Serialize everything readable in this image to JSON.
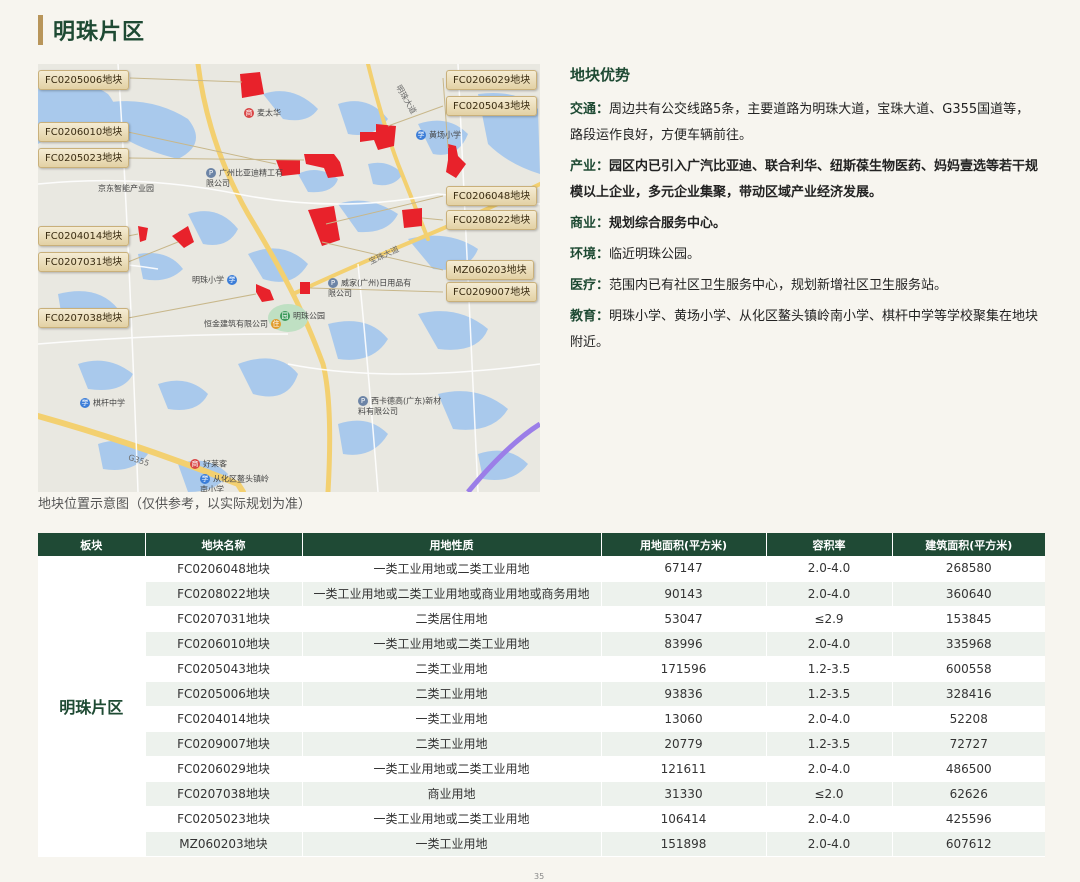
{
  "page": {
    "title": "明珠片区",
    "page_number": "35"
  },
  "map": {
    "caption": "地块位置示意图（仅供参考，以实际规划为准）",
    "parcel_tags": [
      "FC0205006地块",
      "FC0206010地块",
      "FC0205023地块",
      "FC0204014地块",
      "FC0207031地块",
      "FC0207038地块",
      "FC0206029地块",
      "FC0205043地块",
      "FC0206048地块",
      "FC0208022地块",
      "MZ060203地块",
      "FC0209007地块"
    ],
    "pois": {
      "p1": "麦太华",
      "p2": "黄场小学",
      "p3": "广州比亚迪精工有限公司",
      "p4": "京东智能产业园",
      "p5": "明珠小学",
      "p6": "恒金建筑有限公司",
      "p7": "明珠公园",
      "p8": "威家(广州)日用品有限公司",
      "p9": "棋杆中学",
      "p10": "西卡德高(广东)新材料有限公司",
      "p11": "好莱客",
      "p12": "从化区鳌头镇岭南小学"
    },
    "roads": {
      "r1": "明珠大道",
      "r2": "宝珠大道",
      "r3": "G355"
    }
  },
  "advantages": {
    "title": "地块优势",
    "items": [
      {
        "label": "交通：",
        "text": "周边共有公交线路5条，主要道路为明珠大道，宝珠大道、G355国道等，路段运作良好，方便车辆前往。",
        "bold": false
      },
      {
        "label": "产业：",
        "text": "园区内已引入广汽比亚迪、联合利华、纽斯葆生物医药、妈妈壹选等若干规模以上企业，多元企业集聚，带动区域产业经济发展。",
        "bold": true
      },
      {
        "label": "商业：",
        "text": "规划综合服务中心。",
        "bold": true
      },
      {
        "label": "环境：",
        "text": "临近明珠公园。",
        "bold": false
      },
      {
        "label": "医疗：",
        "text": "范围内已有社区卫生服务中心，规划新增社区卫生服务站。",
        "bold": false
      },
      {
        "label": "教育：",
        "text": "明珠小学、黄场小学、从化区鳌头镇岭南小学、棋杆中学等学校聚集在地块附近。",
        "bold": false
      }
    ]
  },
  "table": {
    "headers": [
      "板块",
      "地块名称",
      "用地性质",
      "用地面积(平方米)",
      "容积率",
      "建筑面积(平方米)"
    ],
    "region": "明珠片区",
    "rows": [
      [
        "FC0206048地块",
        "一类工业用地或二类工业用地",
        "67147",
        "2.0-4.0",
        "268580"
      ],
      [
        "FC0208022地块",
        "一类工业用地或二类工业用地或商业用地或商务用地",
        "90143",
        "2.0-4.0",
        "360640"
      ],
      [
        "FC0207031地块",
        "二类居住用地",
        "53047",
        "≤2.9",
        "153845"
      ],
      [
        "FC0206010地块",
        "一类工业用地或二类工业用地",
        "83996",
        "2.0-4.0",
        "335968"
      ],
      [
        "FC0205043地块",
        "二类工业用地",
        "171596",
        "1.2-3.5",
        "600558"
      ],
      [
        "FC0205006地块",
        "二类工业用地",
        "93836",
        "1.2-3.5",
        "328416"
      ],
      [
        "FC0204014地块",
        "一类工业用地",
        "13060",
        "2.0-4.0",
        "52208"
      ],
      [
        "FC0209007地块",
        "二类工业用地",
        "20779",
        "1.2-3.5",
        "72727"
      ],
      [
        "FC0206029地块",
        "一类工业用地或二类工业用地",
        "121611",
        "2.0-4.0",
        "486500"
      ],
      [
        "FC0207038地块",
        "商业用地",
        "31330",
        "≤2.0",
        "62626"
      ],
      [
        "FC0205023地块",
        "一类工业用地或二类工业用地",
        "106414",
        "2.0-4.0",
        "425596"
      ],
      [
        "MZ060203地块",
        "一类工业用地",
        "151898",
        "2.0-4.0",
        "607612"
      ]
    ]
  },
  "colors": {
    "accent": "#1f4a35",
    "gold": "#b8955a",
    "parcel": "#e8222b",
    "water": "#a7c8ea",
    "road": "#f6d46a"
  }
}
